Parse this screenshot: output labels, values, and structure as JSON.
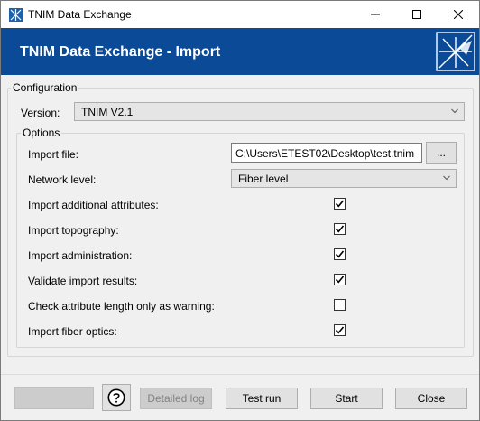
{
  "window": {
    "title": "TNIM Data Exchange",
    "icon": "tnim-app-icon"
  },
  "header": {
    "title": "TNIM Data Exchange - Import",
    "background": "#0a4a96",
    "logo": "tnim-star-logo"
  },
  "configuration": {
    "legend": "Configuration",
    "version_label": "Version:",
    "version_value": "TNIM V2.1"
  },
  "options": {
    "legend": "Options",
    "import_file_label": "Import file:",
    "import_file_value": "C:\\Users\\ETEST02\\Desktop\\test.tnim",
    "browse_label": "...",
    "network_level_label": "Network level:",
    "network_level_value": "Fiber level",
    "checks": [
      {
        "label": "Import additional attributes:",
        "checked": true
      },
      {
        "label": "Import topography:",
        "checked": true
      },
      {
        "label": "Import administration:",
        "checked": true
      },
      {
        "label": "Validate import results:",
        "checked": true
      },
      {
        "label": "Check attribute length only as warning:",
        "checked": false
      },
      {
        "label": "Import fiber optics:",
        "checked": true
      }
    ]
  },
  "footer": {
    "detailed_log_label": "Detailed log",
    "test_run_label": "Test run",
    "start_label": "Start",
    "close_label": "Close",
    "help_icon": "help-question-icon"
  }
}
